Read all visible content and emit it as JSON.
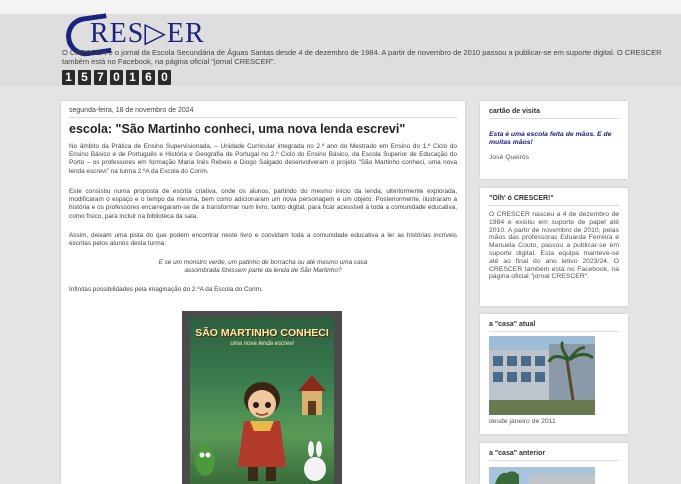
{
  "header": {
    "logo_text": "RES▷ER",
    "description": "O CRESCER é o jornal da Escola Secundária de Águas Santas desde 4 de dezembro de 1984. A partir de novembro de 2010 passou a publicar-se em suporte digital. O CRESCER também está no Facebook, na página oficial \"jornal CRESCER\".",
    "counter_digits": [
      "1",
      "5",
      "7",
      "0",
      "1",
      "6",
      "0"
    ]
  },
  "post": {
    "date": "segunda-feira, 18 de novembro de 2024",
    "title": "escola: \"São Martinho conheci, uma nova lenda escrevi\"",
    "p1": "No âmbito da Prática de Ensino Supervisionada, – Unidade Curricular integrada no 2.º ano do Mestrado em Ensino do 1.º Ciclo do Ensino Básico e de Português e História e Geografia de Portugal no 2.º Ciclo do Ensino Básico, da Escola Superior de Educação do Porto – os professores em formação Maria Inês Rebelo e Diogo Salgado desenvolveram o projeto \"São Martinho conheci, uma nova lenda escrevi\" na turma 2.ºA da Escola do Corim.",
    "p2": "Este consistiu numa proposta de escrita criativa, onde os alunos, partindo do mesmo início da lenda, ulteriormente explorada, modificaram o espaço e o tempo da mesma, bem como adicionaram um nova personagem e um objeto. Posteriormente, ilustraram a história e os professores encarregaram-se de a transformar num livro, tanto digital, para ficar acessível a toda a comunidade educativa, como físico, para incluir na biblioteca da sala.",
    "p3": "Assim, deixam uma pista do que podem encontrar neste livro e convidam toda a comunidade educativa a ler as histórias incríveis escritas pelos alunos desta turma:",
    "quote": "E se um monstro verde, um patinho de borracha ou até mesmo uma casa assombrada fizessem parte da lenda de São Martinho?",
    "p4": "Infinitas possibilidades pela imaginação do 2.ºA da Escola do Corim.",
    "book_title": "SÃO MARTINHO CONHECI",
    "book_subtitle": "uma nova lenda escrevi"
  },
  "sidebar": {
    "card1": {
      "heading": "cartão de visita",
      "tagline": "Esta é uma escola feita de mãos. E de muitas mãos!",
      "author": "José Queirós"
    },
    "card2": {
      "heading": "\"Olh' ó CRESCER!\"",
      "text": "O CRESCER nasceu a 4 de dezembro de 1984 e existiu em suporte de papel até 2010. A partir de novembro de 2010, pelas mãos das professoras Eduarda Ferreira e Manuela Couto, passou a publicar-se em suporte digital. Esta equipa manteve-se até ao final do ano letivo 2023/24. O CRESCER também está no Facebook, na página oficial \"jornal CRESCER\"."
    },
    "card3": {
      "heading": "a \"casa\" atual",
      "caption": "desde janeiro de 2011"
    },
    "card4": {
      "heading": "a \"casa\" anterior"
    }
  }
}
